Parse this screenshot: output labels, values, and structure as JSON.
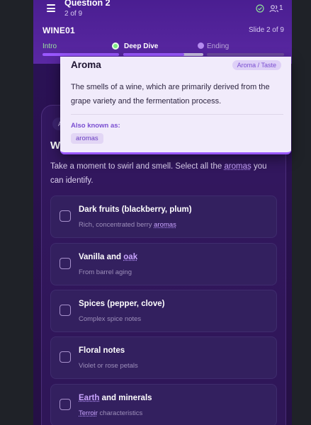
{
  "header": {
    "question_title": "Question 2",
    "question_sub": "2 of 9",
    "users_count": "1",
    "session_code": "WINE01",
    "slide_of": "Slide 2 of 9",
    "steps": [
      {
        "label": "Intro",
        "state": "done"
      },
      {
        "label": "Deep Dive",
        "state": "current"
      },
      {
        "label": "Ending",
        "state": "upcoming"
      }
    ],
    "progress": {
      "intro": 1.0,
      "deep_dive": 0.75,
      "ending": 0.0
    }
  },
  "question": {
    "badge": "A",
    "title": "W",
    "prompt_before": "Take a moment to swirl and smell. Select all the ",
    "prompt_term": "aromas",
    "prompt_after": " you can identify."
  },
  "options": [
    {
      "label": "Dark fruits (blackberry, plum)",
      "desc_before": "Rich, concentrated berry ",
      "desc_term": "aromas",
      "desc_after": ""
    },
    {
      "label_before": "Vanilla and ",
      "label_term": "oak",
      "desc": "From barrel aging"
    },
    {
      "label": "Spices (pepper, clove)",
      "desc": "Complex spice notes"
    },
    {
      "label": "Floral notes",
      "desc": "Violet or rose petals"
    },
    {
      "label_term": "Earth",
      "label_after": " and minerals",
      "desc_term": "Terroir",
      "desc_after": " characteristics"
    }
  ],
  "popover": {
    "title": "Aroma",
    "tag": "Aroma / Taste",
    "definition": "The smells of a wine, which are primarily derived from the grape variety and the fermentation process.",
    "aka_label": "Also known as:",
    "aka": [
      "aromas"
    ]
  },
  "colors": {
    "accent": "#9a58ff",
    "done": "#9be49f",
    "background": "#2a1258"
  }
}
